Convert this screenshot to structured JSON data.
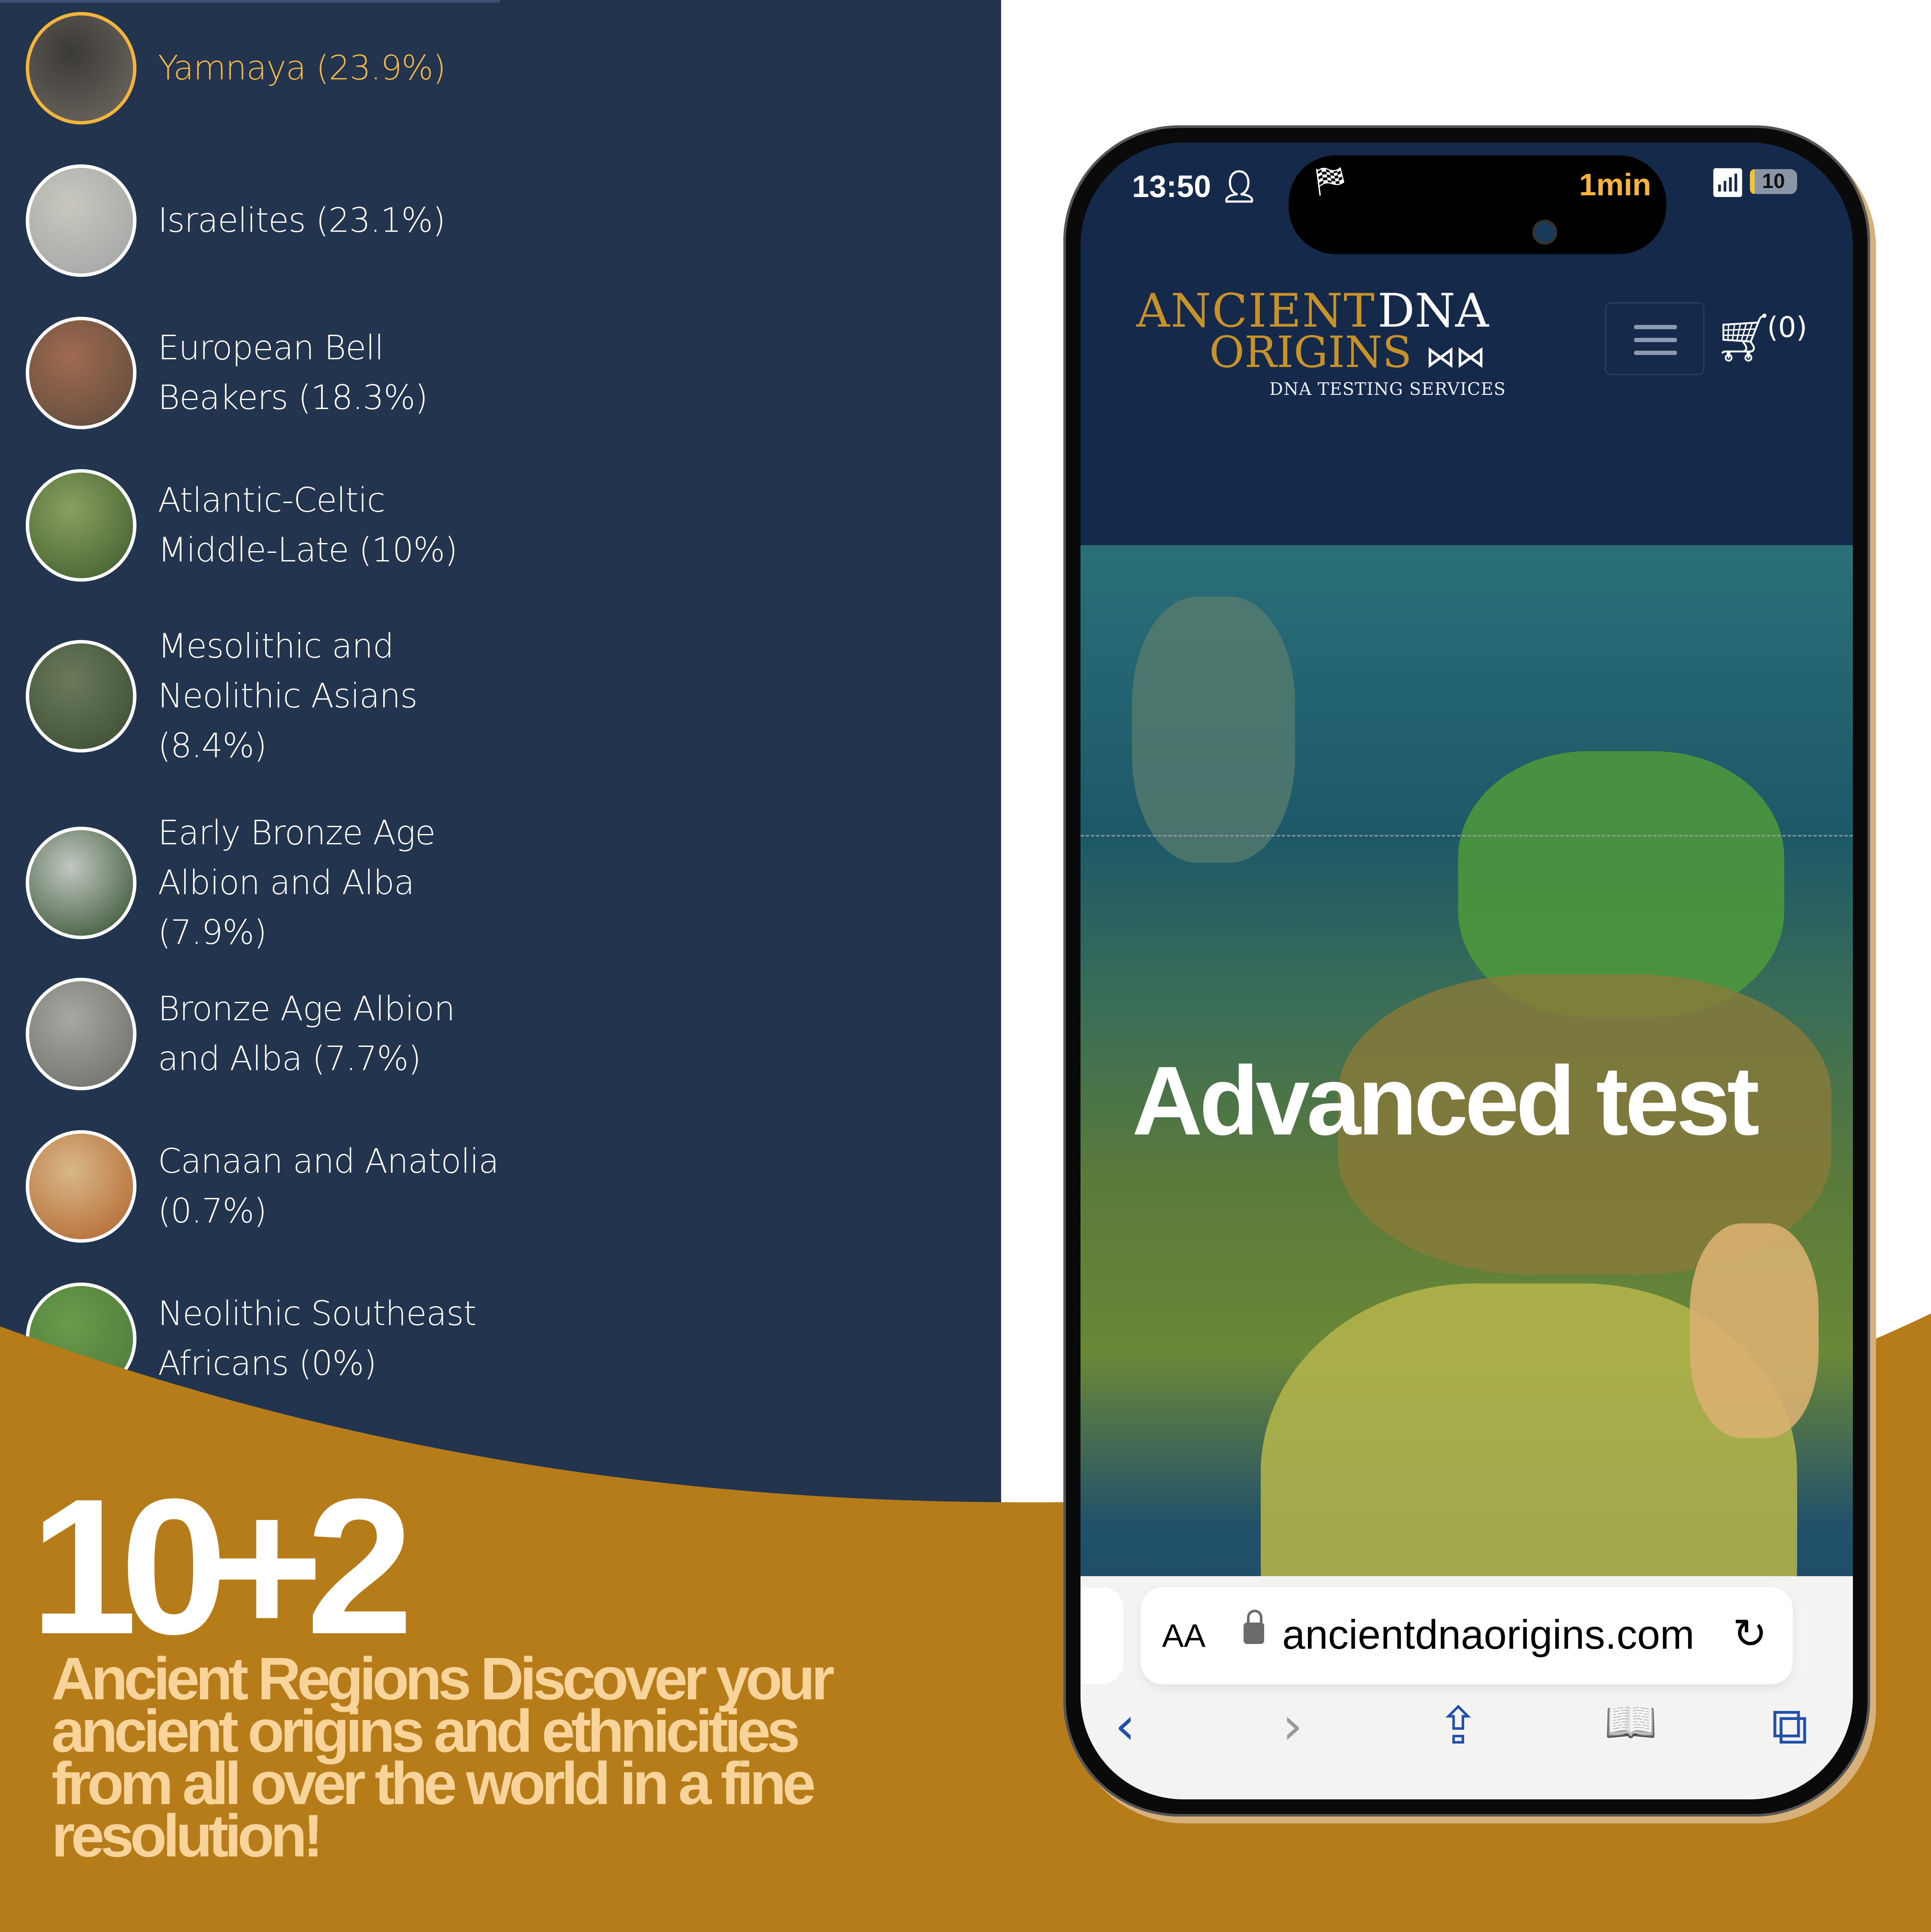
{
  "ethnicities": [
    {
      "label": "Yamnaya (23.9%)",
      "name": "Yamnaya",
      "percent": 23.9,
      "active": true,
      "image_colors": [
        "#6f6a63",
        "#3c3a36"
      ]
    },
    {
      "label": "Israelites (23.1%)",
      "name": "Israelites",
      "percent": 23.1,
      "active": false,
      "image_colors": [
        "#9ea3a3",
        "#c9c7bf"
      ]
    },
    {
      "label": "European Bell Beakers (18.3%)",
      "name": "European Bell Beakers",
      "percent": 18.3,
      "active": false,
      "image_colors": [
        "#5a4a3a",
        "#a06a50"
      ]
    },
    {
      "label": "Atlantic-Celtic Middle-Late (10%)",
      "name": "Atlantic-Celtic Middle-Late",
      "percent": 10,
      "active": false,
      "image_colors": [
        "#3c5a2a",
        "#8aa060"
      ]
    },
    {
      "label": "Mesolithic and Neolithic Asians (8.4%)",
      "name": "Mesolithic and Neolithic Asians",
      "percent": 8.4,
      "active": false,
      "image_colors": [
        "#3a4a30",
        "#6a7a5a"
      ]
    },
    {
      "label": "Early Bronze Age Albion and Alba (7.9%)",
      "name": "Early Bronze Age Albion and Alba",
      "percent": 7.9,
      "active": false,
      "image_colors": [
        "#2f4a2a",
        "#c0c8c0"
      ]
    },
    {
      "label": "Bronze Age Albion and Alba (7.7%)",
      "name": "Bronze Age Albion and Alba",
      "percent": 7.7,
      "active": false,
      "image_colors": [
        "#6a6a66",
        "#a8a8a2"
      ]
    },
    {
      "label": "Canaan and Anatolia (0.7%)",
      "name": "Canaan and Anatolia",
      "percent": 0.7,
      "active": false,
      "image_colors": [
        "#b0622a",
        "#d8b888"
      ]
    },
    {
      "label": "Neolithic Southeast Africans (0%)",
      "name": "Neolithic Southeast Africans",
      "percent": 0,
      "active": false,
      "image_colors": [
        "#4a7a3a",
        "#6a9a4a"
      ]
    }
  ],
  "promo": {
    "headline": "10+2",
    "tagline": "Ancient Regions Discover your ancient origins and ethnicities from all over the world in a fine resolution!"
  },
  "colors": {
    "navy": "#23344e",
    "gold": "#b67c1a",
    "accent_yellow": "#f2b84a",
    "tagline": "#f9d49a",
    "link_blue": "#2150a8"
  },
  "phone": {
    "status": {
      "time": "13:50",
      "person_icon": "person-icon",
      "live_activity_icon": "checkered-flag-icon",
      "timer": "1min",
      "wifi_icon": "wifi-icon",
      "battery_level": "10"
    },
    "site": {
      "logo_word1": "ANCIENT",
      "logo_word2": "DNA",
      "logo_word3": "ORIGINS",
      "logo_sub": "DNA TESTING SERVICES",
      "menu_icon": "hamburger-icon",
      "cart_icon": "cart-icon",
      "cart_count": "(0)"
    },
    "hero": {
      "title": "Advanced test"
    },
    "browser": {
      "text_size": "AA",
      "url": "ancientdnaorigins.com",
      "back": "‹",
      "forward": "›",
      "share": "⇪",
      "bookmarks": "📖",
      "tabs": "⧉",
      "reload": "↻"
    }
  }
}
